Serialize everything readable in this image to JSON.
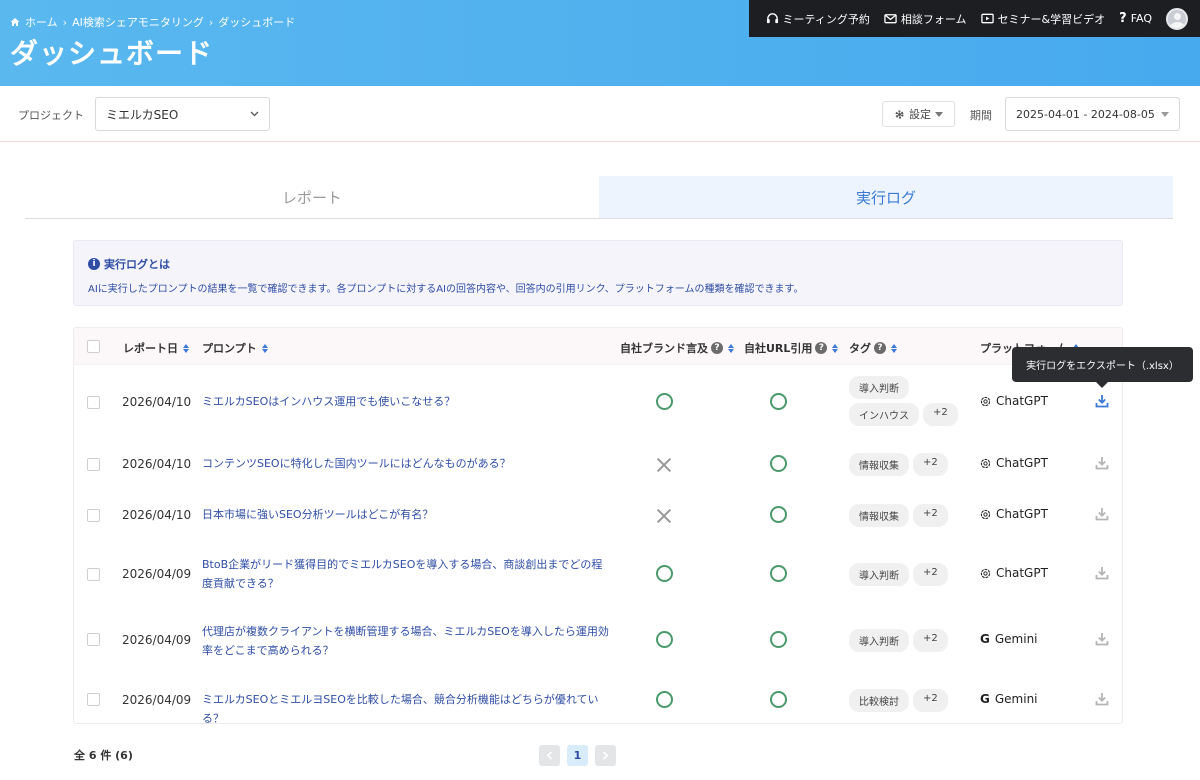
{
  "header": {
    "breadcrumb": [
      "ホーム",
      "AI検索シェアモニタリング",
      "ダッシュボード"
    ],
    "title": "ダッシュボード",
    "nav": {
      "meeting": "ミーティング予約",
      "consult": "相談フォーム",
      "seminar": "セミナー&学習ビデオ",
      "faq": "FAQ"
    }
  },
  "projectbar": {
    "project_label": "プロジェクト",
    "project_value": "ミエルカSEO",
    "settings_label": "設定",
    "period_label": "期間",
    "period_value": "2025-04-01 - 2024-08-05"
  },
  "tabs": {
    "report": "レポート",
    "log": "実行ログ"
  },
  "info": {
    "title": "実行ログとは",
    "desc": "AIに実行したプロンプトの結果を一覧で確認できます。各プロンプトに対するAIの回答内容や、回答内の引用リンク、プラットフォームの種類を確認できます。"
  },
  "table": {
    "headers": {
      "date": "レポート日",
      "prompt": "プロンプト",
      "brand": "自社ブランド言及",
      "url": "自社URL引用",
      "tag": "タグ",
      "platform": "プラットフォーム"
    },
    "rows": [
      {
        "date": "2026/04/10",
        "prompt": "ミエルカSEOはインハウス運用でも使いこなせる？",
        "brand": true,
        "url": true,
        "tags": [
          "導入判断",
          "インハウス",
          "+2"
        ],
        "platform": "ChatGPT"
      },
      {
        "date": "2026/04/10",
        "prompt": "コンテンツSEOに特化した国内ツールにはどんなものがある？",
        "brand": false,
        "url": true,
        "tags": [
          "情報収集",
          "+2"
        ],
        "platform": "ChatGPT"
      },
      {
        "date": "2026/04/10",
        "prompt": "日本市場に強いSEO分析ツールはどこが有名？",
        "brand": false,
        "url": true,
        "tags": [
          "情報収集",
          "+2"
        ],
        "platform": "ChatGPT"
      },
      {
        "date": "2026/04/09",
        "prompt": "BtoB企業がリード獲得目的でミエルカSEOを導入する場合、商談創出までどの程度貢献できる？",
        "brand": true,
        "url": true,
        "tags": [
          "導入判断",
          "+2"
        ],
        "platform": "ChatGPT"
      },
      {
        "date": "2026/04/09",
        "prompt": "代理店が複数クライアントを横断管理する場合、ミエルカSEOを導入したら運用効率をどこまで高められる？",
        "brand": true,
        "url": true,
        "tags": [
          "導入判断",
          "+2"
        ],
        "platform": "Gemini"
      },
      {
        "date": "2026/04/09",
        "prompt": "ミエルカSEOとミエルヨSEOを比較した場合、競合分析機能はどちらが優れている？",
        "brand": true,
        "url": true,
        "tags": [
          "比較検討",
          "+2"
        ],
        "platform": "Gemini"
      }
    ]
  },
  "tooltip": "実行ログをエクスポート（.xlsx）",
  "footer": {
    "total": "全 6 件 (6)",
    "current_page": "1"
  },
  "colors": {
    "header_blue": "#4aaeee",
    "accent_blue": "#2f4da5",
    "check_green": "#4a9a6b"
  }
}
